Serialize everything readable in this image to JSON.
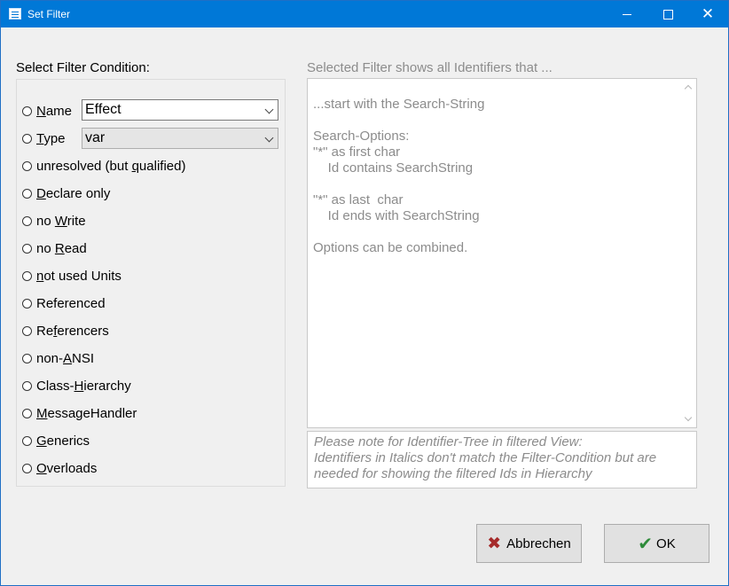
{
  "window": {
    "title": "Set Filter",
    "close_glyph": "✕"
  },
  "filter": {
    "caption": "Select Filter Condition:",
    "name_combo_value": "Effect",
    "type_combo_value": "var",
    "options": [
      {
        "pre": "",
        "acc": "N",
        "post": "ame"
      },
      {
        "pre": "",
        "acc": "T",
        "post": "ype"
      },
      {
        "pre": "unresolved (but ",
        "acc": "q",
        "post": "ualified)"
      },
      {
        "pre": "",
        "acc": "D",
        "post": "eclare only"
      },
      {
        "pre": "no ",
        "acc": "W",
        "post": "rite"
      },
      {
        "pre": "no ",
        "acc": "R",
        "post": "ead"
      },
      {
        "pre": "",
        "acc": "n",
        "post": "ot used Units"
      },
      {
        "pre": "Referenced",
        "acc": "",
        "post": ""
      },
      {
        "pre": "Re",
        "acc": "f",
        "post": "erencers"
      },
      {
        "pre": "non-",
        "acc": "A",
        "post": "NSI"
      },
      {
        "pre": "Class-",
        "acc": "H",
        "post": "ierarchy"
      },
      {
        "pre": "",
        "acc": "M",
        "post": "essageHandler"
      },
      {
        "pre": "",
        "acc": "G",
        "post": "enerics"
      },
      {
        "pre": "",
        "acc": "O",
        "post": "verloads"
      }
    ]
  },
  "description": {
    "caption": "Selected Filter shows all Identifiers that ...",
    "text": "...start with the Search-String\n\nSearch-Options:\n\"*\" as first char\n    Id contains SearchString\n\n\"*\" as last  char\n    Id ends with SearchString\n\nOptions can be combined."
  },
  "note": {
    "line1": "Please note for Identifier-Tree in filtered View:",
    "line2": "Identifiers in Italics don't match the Filter-Condition but are",
    "line3": "needed for showing the filtered Ids in Hierarchy"
  },
  "buttons": {
    "cancel_label": "Abbrechen",
    "ok_label": "OK",
    "cancel_glyph": "✖",
    "ok_glyph": "✔"
  },
  "icons": {
    "app": "list-icon",
    "cancel": "x-icon",
    "ok": "checkmark-icon"
  },
  "colors": {
    "titlebar": "#0078d7",
    "cancel_icon": "#a52a2a",
    "ok_icon": "#2e8b3a"
  }
}
